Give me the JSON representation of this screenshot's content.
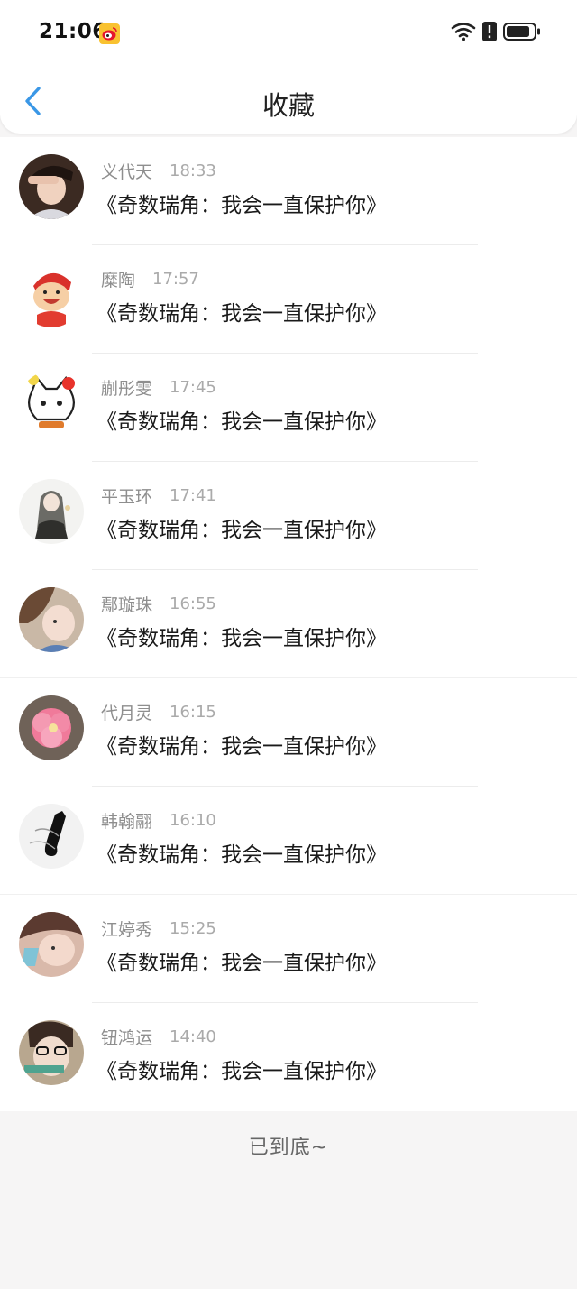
{
  "status_bar": {
    "time": "21:06",
    "app_badge_icon": "weibo-icon",
    "icons": [
      "wifi-icon",
      "alert-icon",
      "battery-icon"
    ]
  },
  "nav": {
    "back_icon": "chevron-left-icon",
    "title": "收藏"
  },
  "colors": {
    "accent": "#3a97e6",
    "title_text": "#1a1a1a",
    "name_text": "#8e8e8e",
    "time_text": "#aaaaaa",
    "page_bg": "#f6f5f5"
  },
  "favorites": [
    {
      "name": "义代天",
      "time": "18:33",
      "title": "《奇数瑞角：我会一直保护你》"
    },
    {
      "name": "糜陶",
      "time": "17:57",
      "title": "《奇数瑞角：我会一直保护你》"
    },
    {
      "name": "蒯彤雯",
      "time": "17:45",
      "title": "《奇数瑞角：我会一直保护你》"
    },
    {
      "name": "平玉环",
      "time": "17:41",
      "title": "《奇数瑞角：我会一直保护你》"
    },
    {
      "name": "鄢璇珠",
      "time": "16:55",
      "title": "《奇数瑞角：我会一直保护你》"
    },
    {
      "name": "代月灵",
      "time": "16:15",
      "title": "《奇数瑞角：我会一直保护你》"
    },
    {
      "name": "韩翰翮",
      "time": "16:10",
      "title": "《奇数瑞角：我会一直保护你》"
    },
    {
      "name": "江婷秀",
      "time": "15:25",
      "title": "《奇数瑞角：我会一直保护你》"
    },
    {
      "name": "钮鸿运",
      "time": "14:40",
      "title": "《奇数瑞角：我会一直保护你》"
    }
  ],
  "footer": {
    "end_text": "已到底~"
  }
}
